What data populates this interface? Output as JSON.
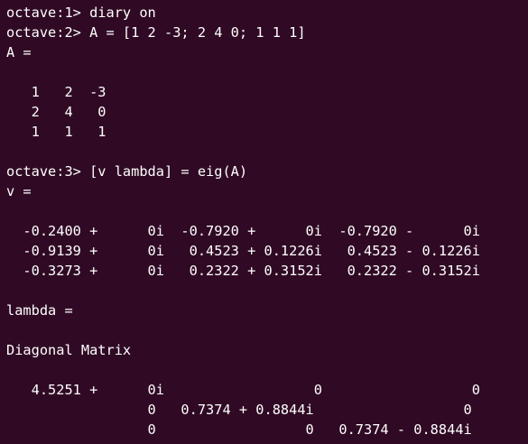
{
  "terminal": {
    "lines": [
      "octave:1> diary on",
      "octave:2> A = [1 2 -3; 2 4 0; 1 1 1]",
      "A =",
      "",
      "   1   2  -3",
      "   2   4   0",
      "   1   1   1",
      "",
      "octave:3> [v lambda] = eig(A)",
      "v =",
      "",
      "  -0.2400 +      0i  -0.7920 +      0i  -0.7920 -      0i",
      "  -0.9139 +      0i   0.4523 + 0.1226i   0.4523 - 0.1226i",
      "  -0.3273 +      0i   0.2322 + 0.3152i   0.2322 - 0.3152i",
      "",
      "lambda =",
      "",
      "Diagonal Matrix",
      "",
      "   4.5251 +      0i                  0                  0",
      "                 0   0.7374 + 0.8844i                  0",
      "                 0                  0   0.7374 - 0.8844i"
    ]
  }
}
